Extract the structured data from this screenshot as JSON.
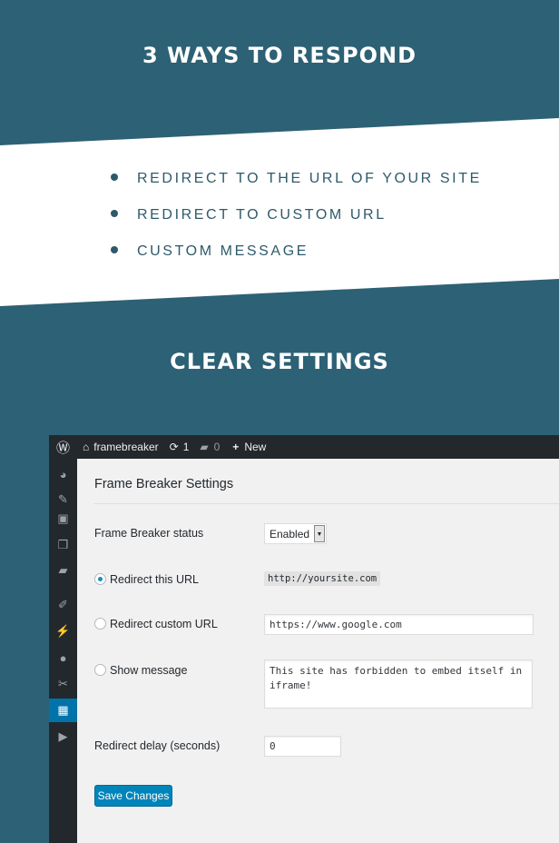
{
  "hero": {
    "title": "3 WAYS TO RESPOND",
    "features": [
      "REDIRECT TO THE URL OF YOUR SITE",
      "REDIRECT TO CUSTOM URL",
      "CUSTOM MESSAGE"
    ],
    "subtitle": "CLEAR SETTINGS"
  },
  "colors": {
    "background": "#2d6175",
    "accent": "#0073aa",
    "admin_bar": "#23282d"
  },
  "adminbar": {
    "site": "framebreaker",
    "updates": "1",
    "comments": "0",
    "new": "New"
  },
  "sidebar": {
    "icons": [
      "dashboard-icon",
      "pin-icon",
      "media-icon",
      "pages-icon",
      "comments-icon",
      "appearance-icon",
      "plugins-icon",
      "users-icon",
      "tools-icon",
      "settings-icon",
      "play-icon"
    ],
    "active": "settings-icon"
  },
  "settings": {
    "title": "Frame Breaker Settings",
    "status_label": "Frame Breaker status",
    "status_value": "Enabled",
    "redirect_this_label": "Redirect this URL",
    "redirect_this_value": "http://yoursite.com",
    "redirect_custom_label": "Redirect custom URL",
    "redirect_custom_value": "https://www.google.com",
    "message_label": "Show message",
    "message_value": "This site has forbidden to embed itself in iframe!",
    "selected": "Redirect this URL",
    "delay_label": "Redirect delay (seconds)",
    "delay_value": "0",
    "save": "Save Changes"
  }
}
